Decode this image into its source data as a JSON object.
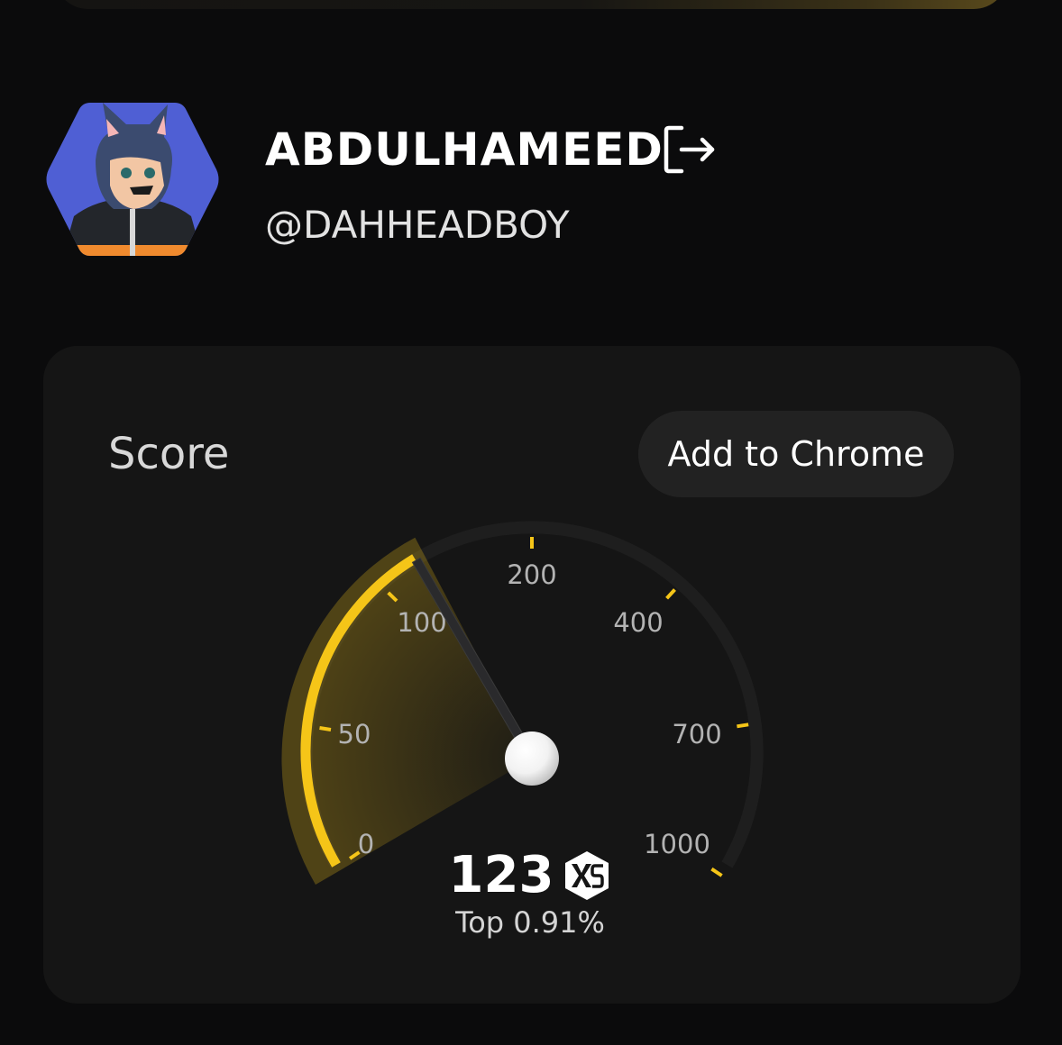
{
  "profile": {
    "display_name": "ABDULHAMEED",
    "handle": "@DAHHEADBOY",
    "avatar_icon": "wolf-avatar-icon",
    "logout_icon": "logout-icon"
  },
  "score_card": {
    "title": "Score",
    "add_button_label": "Add to Chrome",
    "score_value": "123",
    "badge_icon": "xs-badge-icon",
    "rank_text": "Top 0.91%",
    "accent_color": "#f5c518",
    "track_color": "#1e1e1e"
  },
  "gauge": {
    "tick_labels": [
      "0",
      "50",
      "100",
      "200",
      "400",
      "700",
      "1000"
    ]
  }
}
